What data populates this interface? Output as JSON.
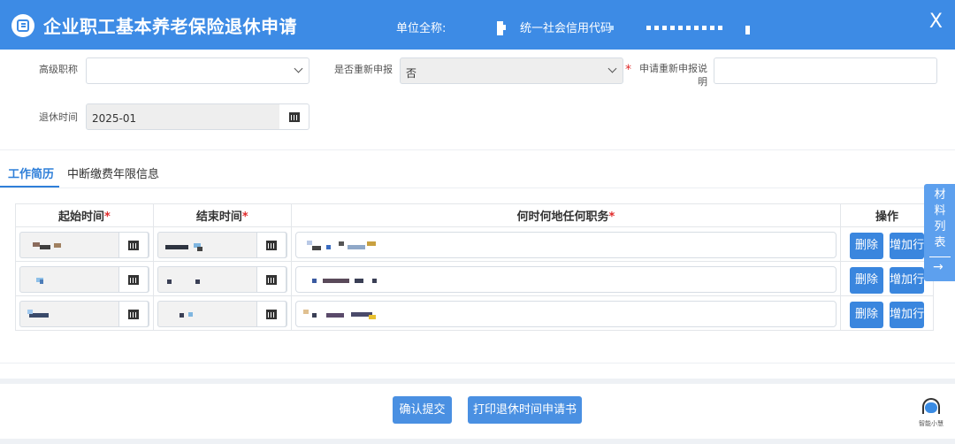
{
  "header": {
    "title": "企业职工基本养老保险退休申请",
    "unit_label": "单位全称:",
    "credit_label": "统一社会信用代码",
    "close": "X"
  },
  "form": {
    "title_label": "高级职称",
    "title_value": "",
    "reapply_label": "是否重新申报",
    "reapply_value": "否",
    "reapply_note_label": "申请重新申报说明",
    "retire_label": "退休时间",
    "retire_value": "2025-01"
  },
  "tabs": [
    {
      "label": "工作简历",
      "active": true
    },
    {
      "label": "中断缴费年限信息",
      "active": false
    }
  ],
  "table": {
    "headers": [
      "起始时间",
      "结束时间",
      "何时何地任何职务",
      "操作"
    ],
    "rows": 3,
    "delete_label": "删除",
    "add_label": "增加行"
  },
  "side_panel": {
    "label": "材料列表",
    "arrow": "→"
  },
  "footer": {
    "confirm_label": "确认提交",
    "print_label": "打印退休时间申请书",
    "assistant_label": "智能小慧"
  },
  "colors": {
    "primary": "#3d8be5",
    "button": "#3a86de",
    "required": "#e02b2b"
  }
}
